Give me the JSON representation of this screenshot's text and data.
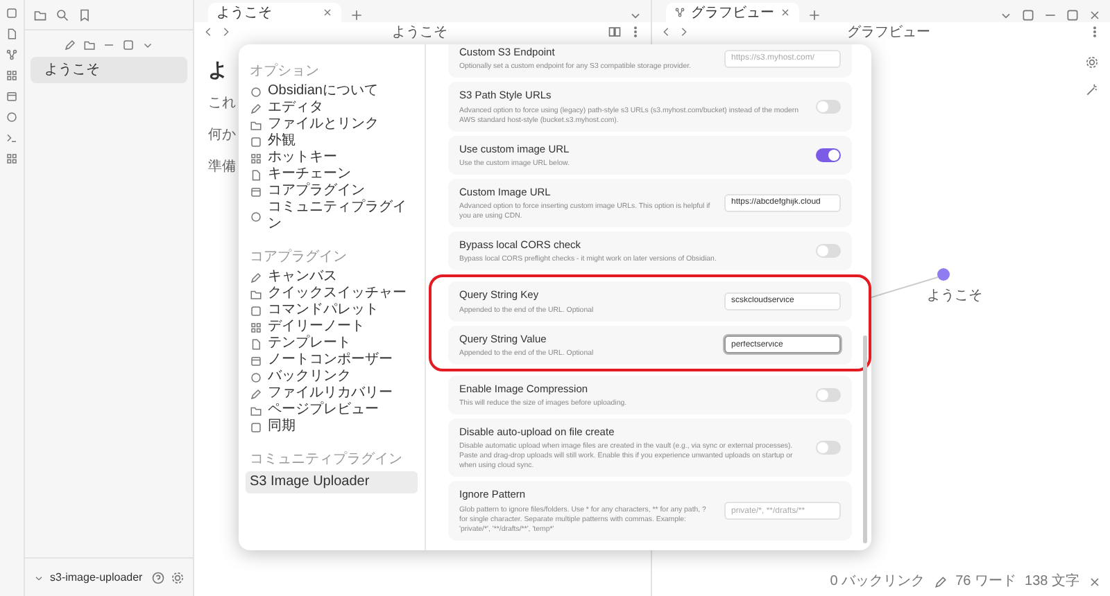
{
  "sidebar": {
    "files": [
      {
        "label": "ようこそ",
        "selected": true
      }
    ],
    "vault": "s3-image-uploader"
  },
  "main": {
    "tab": "ようこそ",
    "title": "ようこそ",
    "note_lines": [
      "これ",
      "何か",
      "準備"
    ],
    "heading": "よ"
  },
  "graph": {
    "tab": "グラフビュー",
    "title": "グラフビュー",
    "node": "ようこそ"
  },
  "settings": {
    "nav": [
      {
        "heading": "オプション",
        "items": [
          {
            "label": "Obsidianについて",
            "selected": false
          },
          {
            "label": "エディタ",
            "selected": false
          },
          {
            "label": "ファイルとリンク",
            "selected": false
          },
          {
            "label": "外観",
            "selected": false
          },
          {
            "label": "ホットキー",
            "selected": false
          },
          {
            "label": "キーチェーン",
            "selected": false
          },
          {
            "label": "コアプラグイン",
            "selected": false
          },
          {
            "label": "コミュニティプラグイン",
            "selected": false
          }
        ]
      },
      {
        "heading": "コアプラグイン",
        "items": [
          {
            "label": "キャンバス",
            "selected": false
          },
          {
            "label": "クイックスイッチャー",
            "selected": false
          },
          {
            "label": "コマンドパレット",
            "selected": false
          },
          {
            "label": "デイリーノート",
            "selected": false
          },
          {
            "label": "テンプレート",
            "selected": false
          },
          {
            "label": "ノートコンポーザー",
            "selected": false
          },
          {
            "label": "バックリンク",
            "selected": false
          },
          {
            "label": "ファイルリカバリー",
            "selected": false
          },
          {
            "label": "ページプレビュー",
            "selected": false
          },
          {
            "label": "同期",
            "selected": false
          }
        ]
      },
      {
        "heading": "コミュニティプラグイン",
        "items": [
          {
            "label": "S3 Image Uploader",
            "selected": true
          }
        ]
      }
    ],
    "rows": [
      {
        "kind": "text",
        "title": "Custom S3 Endpoint",
        "description": "Optionally set a custom endpoint for any S3 compatible storage provider.",
        "placeholder": "https://s3.myhost.com/",
        "focused": false,
        "highlighted": false
      },
      {
        "kind": "toggle",
        "title": "S3 Path Style URLs",
        "description": "Advanced option to force using (legacy) path-style s3 URLs (s3.myhost.com/bucket) instead of the modern AWS standard host-style (bucket.s3.myhost.com).",
        "on": false,
        "highlighted": false
      },
      {
        "kind": "toggle",
        "title": "Use custom image URL",
        "description": "Use the custom image URL below.",
        "on": true,
        "highlighted": false
      },
      {
        "kind": "text",
        "title": "Custom Image URL",
        "description": "Advanced option to force inserting custom image URLs. This option is helpful if you are using CDN.",
        "value": "https://abcdefghijk.cloud",
        "focused": false,
        "highlighted": false
      },
      {
        "kind": "toggle",
        "title": "Bypass local CORS check",
        "description": "Bypass local CORS preflight checks - it might work on later versions of Obsidian.",
        "on": false,
        "highlighted": false
      },
      {
        "kind": "text",
        "title": "Query String Key",
        "description": "Appended to the end of the URL. Optional",
        "value": "scskcloudservice",
        "focused": false,
        "highlighted": true
      },
      {
        "kind": "text",
        "title": "Query String Value",
        "description": "Appended to the end of the URL. Optional",
        "value": "perfectservice",
        "focused": true,
        "highlighted": true
      },
      {
        "kind": "toggle",
        "title": "Enable Image Compression",
        "description": "This will reduce the size of images before uploading.",
        "on": false,
        "highlighted": false
      },
      {
        "kind": "toggle",
        "title": "Disable auto-upload on file create",
        "description": "Disable automatic upload when image files are created in the vault (e.g., via sync or external processes). Paste and drag-drop uploads will still work. Enable this if you experience unwanted uploads on startup or when using cloud sync.",
        "on": false,
        "highlighted": false
      },
      {
        "kind": "text",
        "title": "Ignore Pattern",
        "description": "Glob pattern to ignore files/folders. Use * for any characters, ** for any path, ? for single character. Separate multiple patterns with commas. Example: 'private/*', '**/drafts/**', 'temp*'",
        "placeholder": "private/*, **/drafts/**",
        "focused": false,
        "highlighted": false
      }
    ]
  },
  "status_bar": {
    "backlinks": "0 バックリンク",
    "words": "76 ワード",
    "chars": "138 文字"
  }
}
